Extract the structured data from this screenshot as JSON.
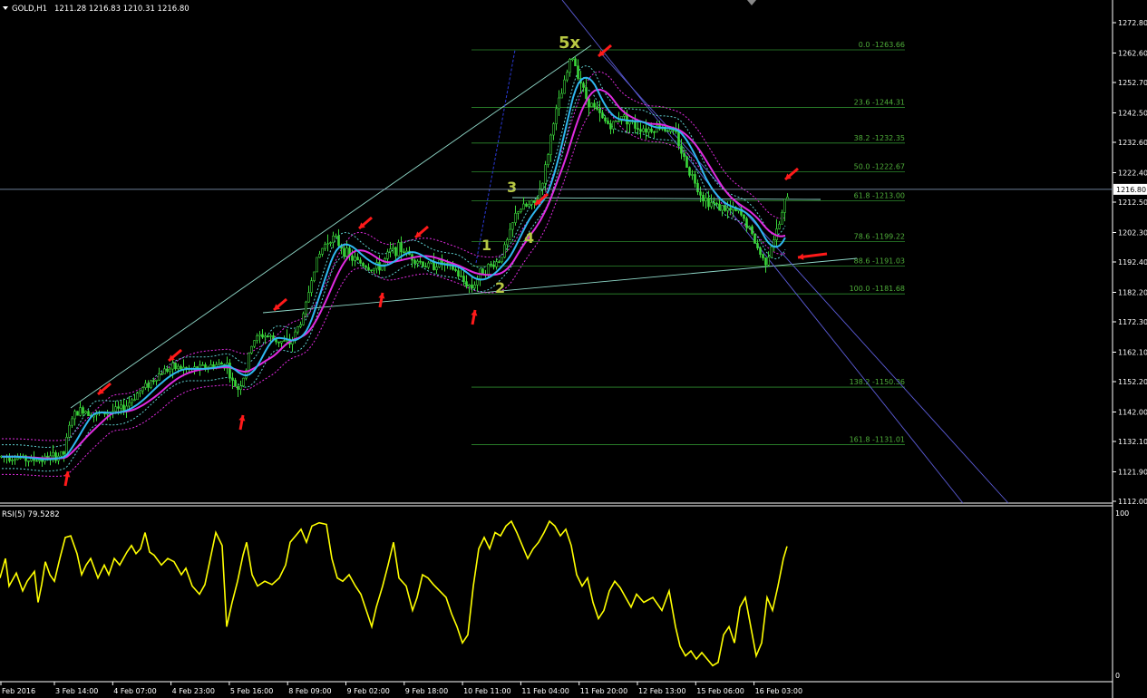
{
  "header": {
    "symbol": "GOLD,H1",
    "ohlc": "1211.28 1216.83 1210.31 1216.80"
  },
  "price_axis": {
    "ticks": [
      "1272.80",
      "1262.60",
      "1252.70",
      "1242.50",
      "1232.60",
      "1222.40",
      "1212.50",
      "1202.30",
      "1192.40",
      "1182.20",
      "1172.30",
      "1162.10",
      "1152.20",
      "1142.00",
      "1132.10",
      "1121.90",
      "1112.00"
    ],
    "current_price_label": "1216.80"
  },
  "time_axis": {
    "labels": [
      "Feb 2016",
      "3 Feb 14:00",
      "4 Feb 07:00",
      "4 Feb 23:00",
      "5 Feb 16:00",
      "8 Feb 09:00",
      "9 Feb 02:00",
      "9 Feb 18:00",
      "10 Feb 11:00",
      "11 Feb 04:00",
      "11 Feb 20:00",
      "12 Feb 13:00",
      "15 Feb 06:00",
      "16 Feb 03:00"
    ]
  },
  "fib_levels": [
    {
      "label": "0.0 -1263.66",
      "price": 1263.66
    },
    {
      "label": "23.6 -1244.31",
      "price": 1244.31
    },
    {
      "label": "38.2 -1232.35",
      "price": 1232.35
    },
    {
      "label": "50.0 -1222.67",
      "price": 1222.67
    },
    {
      "label": "61.8 -1213.00",
      "price": 1213.0
    },
    {
      "label": "78.6 -1199.22",
      "price": 1199.22
    },
    {
      "label": "88.6 -1191.03",
      "price": 1191.03
    },
    {
      "label": "100.0 -1181.68",
      "price": 1181.68
    },
    {
      "label": "138.2 -1150.36",
      "price": 1150.36
    },
    {
      "label": "161.8 -1131.01",
      "price": 1131.01
    }
  ],
  "wave_labels": [
    "1",
    "2",
    "3",
    "4",
    "5x"
  ],
  "rsi": {
    "label": "RSI(5) 79.5282",
    "scale_top": "100",
    "scale_bottom": "0"
  },
  "colors": {
    "background": "#000000",
    "candles": "#3ad63a",
    "ma_fast": "#2fb7f0",
    "ma_slow": "#e02be0",
    "fib": "#2e8b2e",
    "rsi_line": "#ffff00",
    "arrows": "#ff1a1a",
    "channel_lines": "#5b5bd6",
    "trend_lines": "#8fd8c8"
  },
  "chart_data": {
    "type": "candlestick",
    "title": "GOLD,H1",
    "ylim": [
      1112.0,
      1272.8
    ],
    "close_trajectory": [
      [
        0,
        1127
      ],
      [
        15,
        1127
      ],
      [
        30,
        1126
      ],
      [
        45,
        1126
      ],
      [
        60,
        1127
      ],
      [
        70,
        1128
      ],
      [
        78,
        1140
      ],
      [
        90,
        1143
      ],
      [
        105,
        1141
      ],
      [
        120,
        1142
      ],
      [
        135,
        1143
      ],
      [
        150,
        1148
      ],
      [
        165,
        1152
      ],
      [
        180,
        1156
      ],
      [
        195,
        1157
      ],
      [
        210,
        1156
      ],
      [
        225,
        1157
      ],
      [
        240,
        1158
      ],
      [
        250,
        1158
      ],
      [
        255,
        1152
      ],
      [
        262,
        1150
      ],
      [
        270,
        1155
      ],
      [
        278,
        1166
      ],
      [
        290,
        1168
      ],
      [
        305,
        1166
      ],
      [
        320,
        1165
      ],
      [
        335,
        1175
      ],
      [
        345,
        1190
      ],
      [
        355,
        1197
      ],
      [
        365,
        1201
      ],
      [
        375,
        1198
      ],
      [
        385,
        1194
      ],
      [
        398,
        1192
      ],
      [
        410,
        1190
      ],
      [
        420,
        1191
      ],
      [
        430,
        1196
      ],
      [
        440,
        1197
      ],
      [
        455,
        1194
      ],
      [
        470,
        1191
      ],
      [
        485,
        1192
      ],
      [
        500,
        1190
      ],
      [
        510,
        1186
      ],
      [
        520,
        1184
      ],
      [
        530,
        1189
      ],
      [
        540,
        1191
      ],
      [
        550,
        1193
      ],
      [
        560,
        1200
      ],
      [
        570,
        1210
      ],
      [
        580,
        1211
      ],
      [
        590,
        1212
      ],
      [
        600,
        1222
      ],
      [
        610,
        1240
      ],
      [
        620,
        1250
      ],
      [
        630,
        1262
      ],
      [
        638,
        1255
      ],
      [
        645,
        1248
      ],
      [
        655,
        1244
      ],
      [
        665,
        1240
      ],
      [
        675,
        1238
      ],
      [
        685,
        1242
      ],
      [
        700,
        1238
      ],
      [
        715,
        1237
      ],
      [
        730,
        1238
      ],
      [
        745,
        1235
      ],
      [
        755,
        1226
      ],
      [
        765,
        1220
      ],
      [
        775,
        1214
      ],
      [
        785,
        1212
      ],
      [
        800,
        1210
      ],
      [
        815,
        1209
      ],
      [
        825,
        1204
      ],
      [
        835,
        1197
      ],
      [
        843,
        1192
      ],
      [
        850,
        1198
      ],
      [
        858,
        1204
      ],
      [
        865,
        1212
      ],
      [
        870,
        1216.8
      ]
    ],
    "rsi_trajectory": [
      [
        0,
        60
      ],
      [
        6,
        72
      ],
      [
        10,
        55
      ],
      [
        18,
        63
      ],
      [
        25,
        52
      ],
      [
        30,
        58
      ],
      [
        38,
        64
      ],
      [
        42,
        45
      ],
      [
        46,
        56
      ],
      [
        50,
        70
      ],
      [
        55,
        62
      ],
      [
        60,
        58
      ],
      [
        66,
        72
      ],
      [
        72,
        85
      ],
      [
        78,
        86
      ],
      [
        85,
        75
      ],
      [
        90,
        62
      ],
      [
        95,
        68
      ],
      [
        100,
        72
      ],
      [
        108,
        60
      ],
      [
        115,
        68
      ],
      [
        120,
        62
      ],
      [
        126,
        72
      ],
      [
        132,
        68
      ],
      [
        140,
        76
      ],
      [
        145,
        80
      ],
      [
        150,
        75
      ],
      [
        155,
        78
      ],
      [
        160,
        88
      ],
      [
        165,
        76
      ],
      [
        170,
        74
      ],
      [
        178,
        68
      ],
      [
        185,
        72
      ],
      [
        192,
        70
      ],
      [
        200,
        62
      ],
      [
        205,
        66
      ],
      [
        212,
        55
      ],
      [
        220,
        50
      ],
      [
        226,
        56
      ],
      [
        232,
        72
      ],
      [
        238,
        88
      ],
      [
        245,
        80
      ],
      [
        250,
        30
      ],
      [
        256,
        45
      ],
      [
        262,
        58
      ],
      [
        268,
        74
      ],
      [
        272,
        82
      ],
      [
        278,
        62
      ],
      [
        284,
        55
      ],
      [
        292,
        58
      ],
      [
        300,
        56
      ],
      [
        308,
        60
      ],
      [
        315,
        68
      ],
      [
        320,
        82
      ],
      [
        326,
        86
      ],
      [
        332,
        90
      ],
      [
        338,
        82
      ],
      [
        344,
        92
      ],
      [
        352,
        94
      ],
      [
        360,
        93
      ],
      [
        366,
        72
      ],
      [
        372,
        60
      ],
      [
        378,
        58
      ],
      [
        385,
        62
      ],
      [
        392,
        55
      ],
      [
        398,
        50
      ],
      [
        404,
        40
      ],
      [
        410,
        30
      ],
      [
        415,
        42
      ],
      [
        422,
        55
      ],
      [
        428,
        68
      ],
      [
        434,
        82
      ],
      [
        440,
        60
      ],
      [
        448,
        55
      ],
      [
        455,
        40
      ],
      [
        460,
        48
      ],
      [
        466,
        62
      ],
      [
        472,
        60
      ],
      [
        478,
        56
      ],
      [
        485,
        52
      ],
      [
        492,
        48
      ],
      [
        498,
        38
      ],
      [
        504,
        30
      ],
      [
        510,
        20
      ],
      [
        516,
        25
      ],
      [
        522,
        55
      ],
      [
        528,
        78
      ],
      [
        534,
        85
      ],
      [
        540,
        78
      ],
      [
        546,
        88
      ],
      [
        552,
        86
      ],
      [
        558,
        92
      ],
      [
        564,
        95
      ],
      [
        570,
        88
      ],
      [
        576,
        80
      ],
      [
        582,
        72
      ],
      [
        588,
        78
      ],
      [
        594,
        82
      ],
      [
        600,
        88
      ],
      [
        606,
        95
      ],
      [
        612,
        92
      ],
      [
        618,
        86
      ],
      [
        624,
        90
      ],
      [
        630,
        80
      ],
      [
        636,
        62
      ],
      [
        642,
        55
      ],
      [
        648,
        60
      ],
      [
        654,
        45
      ],
      [
        660,
        35
      ],
      [
        666,
        40
      ],
      [
        672,
        52
      ],
      [
        678,
        58
      ],
      [
        684,
        54
      ],
      [
        690,
        48
      ],
      [
        696,
        42
      ],
      [
        702,
        50
      ],
      [
        710,
        45
      ],
      [
        720,
        48
      ],
      [
        730,
        40
      ],
      [
        738,
        52
      ],
      [
        745,
        30
      ],
      [
        750,
        18
      ],
      [
        756,
        12
      ],
      [
        762,
        15
      ],
      [
        768,
        10
      ],
      [
        774,
        14
      ],
      [
        780,
        10
      ],
      [
        786,
        6
      ],
      [
        792,
        8
      ],
      [
        798,
        25
      ],
      [
        804,
        30
      ],
      [
        810,
        20
      ],
      [
        816,
        42
      ],
      [
        822,
        48
      ],
      [
        828,
        30
      ],
      [
        834,
        12
      ],
      [
        840,
        20
      ],
      [
        846,
        48
      ],
      [
        852,
        40
      ],
      [
        858,
        55
      ],
      [
        864,
        72
      ],
      [
        868,
        79.5
      ]
    ]
  }
}
